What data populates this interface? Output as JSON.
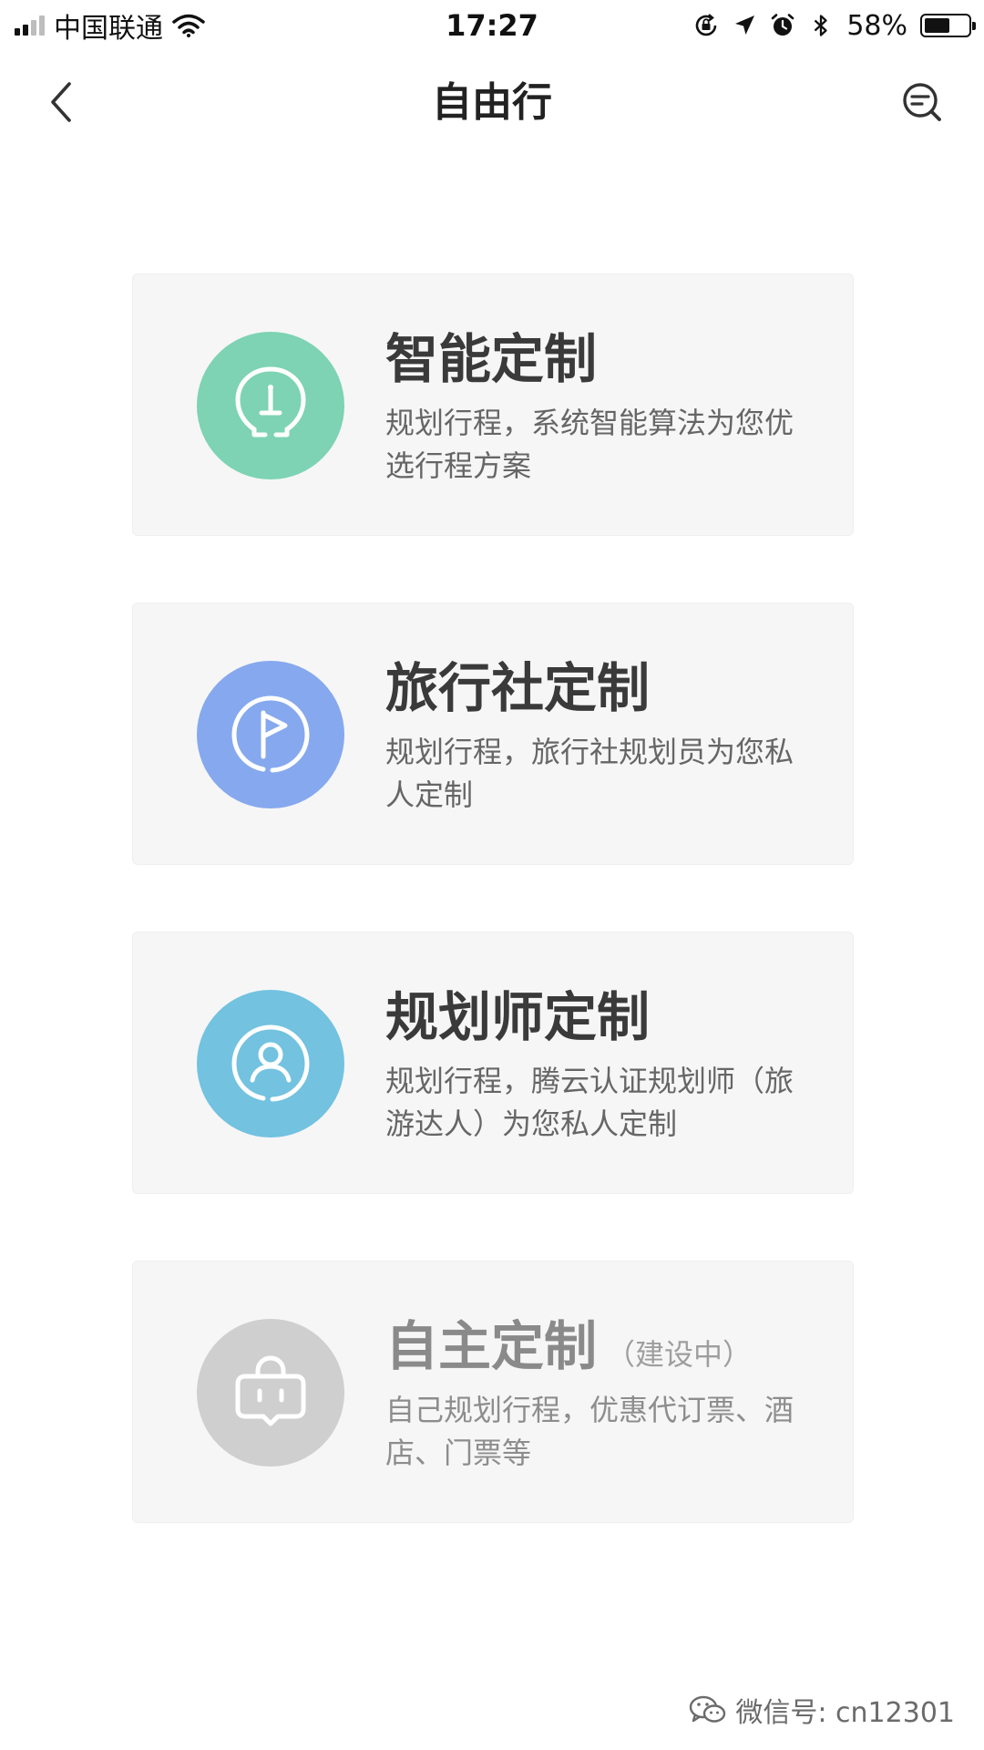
{
  "status_bar": {
    "carrier": "中国联通",
    "time": "17:27",
    "battery_percent": "58%",
    "battery_level": 0.58,
    "icons": [
      "signal-icon",
      "wifi-icon",
      "rotation-lock-icon",
      "location-icon",
      "alarm-icon",
      "bluetooth-icon",
      "battery-icon"
    ]
  },
  "nav": {
    "title": "自由行",
    "back_icon": "chevron-left-icon",
    "right_icon": "search-list-icon"
  },
  "cards": [
    {
      "title": "智能定制",
      "title_suffix": "",
      "description": "规划行程，系统智能算法为您优选行程方案",
      "icon": "lightbulb-icon",
      "icon_color": "#7dd3b3",
      "enabled": true
    },
    {
      "title": "旅行社定制",
      "title_suffix": "",
      "description": "规划行程，旅行社规划员为您私人定制",
      "icon": "flag-icon",
      "icon_color": "#86a8ee",
      "enabled": true
    },
    {
      "title": "规划师定制",
      "title_suffix": "",
      "description": "规划行程，腾云认证规划师（旅游达人）为您私人定制",
      "icon": "person-icon",
      "icon_color": "#72c2e0",
      "enabled": true
    },
    {
      "title": "自主定制",
      "title_suffix": "（建设中）",
      "description": "自己规划行程，优惠代订票、酒店、门票等",
      "icon": "bag-icon",
      "icon_color": "#cfcfcf",
      "enabled": false
    }
  ],
  "watermark": {
    "text": "微信号: cn12301",
    "icon": "wechat-icon"
  }
}
